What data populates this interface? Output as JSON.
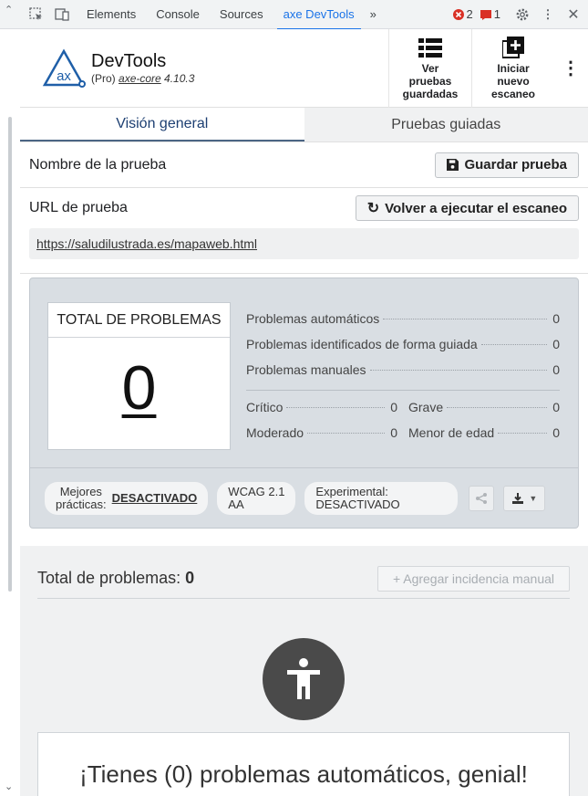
{
  "devtools": {
    "tabs": [
      "Elements",
      "Console",
      "Sources",
      "axe DevTools"
    ],
    "active_tab": "axe DevTools",
    "more": "»",
    "errors_count": "2",
    "warnings_count": "1"
  },
  "header": {
    "logo_text": "ax",
    "title": "DevTools",
    "edition": "(Pro)",
    "core_link": "axe-core",
    "version": "4.10.3",
    "saved_tests_label_1": "Ver",
    "saved_tests_label_2": "pruebas",
    "saved_tests_label_3": "guardadas",
    "new_scan_label_1": "Iniciar",
    "new_scan_label_2": "nuevo",
    "new_scan_label_3": "escaneo"
  },
  "tabs": {
    "overview": "Visión general",
    "guided": "Pruebas guiadas"
  },
  "test": {
    "name_label": "Nombre de la prueba",
    "save_button": "Guardar prueba",
    "url_label": "URL de prueba",
    "rerun_button": "Volver a ejecutar el escaneo",
    "url": "https://saludilustrada.es/mapaweb.html"
  },
  "summary": {
    "total_label": "TOTAL DE PROBLEMAS",
    "total_value": "0",
    "automatic_label": "Problemas automáticos",
    "automatic_value": "0",
    "guided_label": "Problemas identificados de forma guiada",
    "guided_value": "0",
    "manual_label": "Problemas manuales",
    "manual_value": "0",
    "critical_label": "Crítico",
    "critical_value": "0",
    "serious_label": "Grave",
    "serious_value": "0",
    "moderate_label": "Moderado",
    "moderate_value": "0",
    "minor_label": "Menor de edad",
    "minor_value": "0",
    "best_practices_label_1": "Mejores",
    "best_practices_label_2": "prácticas:",
    "best_practices_value": "DESACTIVADO",
    "wcag_line_1": "WCAG 2.1",
    "wcag_line_2": "AA",
    "experimental_line_1": "Experimental:",
    "experimental_line_2": "DESACTIVADO"
  },
  "issues": {
    "total_label": "Total de problemas:",
    "total_value": "0",
    "add_manual": "+ Agregar incidencia manual",
    "congrats": "¡Tienes (0) problemas automáticos, genial!"
  },
  "colors": {
    "accent": "#1a73e8",
    "error": "#d93025",
    "summary_bg": "#d9dee3"
  }
}
